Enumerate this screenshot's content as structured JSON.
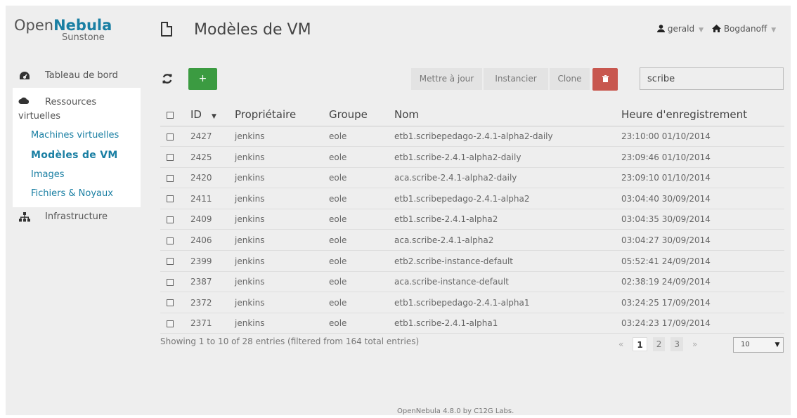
{
  "logo": {
    "open": "Open",
    "nebula": "Nebula",
    "sunstone": "Sunstone"
  },
  "page_title": "Modèles de VM",
  "header": {
    "user": "gerald",
    "zone": "Bogdanoff"
  },
  "sidebar": {
    "dashboard": "Tableau de bord",
    "virtual_resources": {
      "line1": "Ressources",
      "line2": "virtuelles"
    },
    "items": [
      "Machines virtuelles",
      "Modèles de VM",
      "Images",
      "Fichiers & Noyaux"
    ],
    "infrastructure": "Infrastructure"
  },
  "toolbar": {
    "create_label": "+",
    "update_label": "Mettre à jour",
    "instantiate_label": "Instancier",
    "clone_label": "Clone",
    "delete_label": "🗑",
    "search_value": "scribe"
  },
  "table": {
    "columns": [
      "ID",
      "Propriétaire",
      "Groupe",
      "Nom",
      "Heure d'enregistrement"
    ],
    "rows": [
      {
        "id": "2427",
        "owner": "jenkins",
        "group": "eole",
        "name": "etb1.scribepedago-2.4.1-alpha2-daily",
        "time": "23:10:00 01/10/2014"
      },
      {
        "id": "2425",
        "owner": "jenkins",
        "group": "eole",
        "name": "etb1.scribe-2.4.1-alpha2-daily",
        "time": "23:09:46 01/10/2014"
      },
      {
        "id": "2420",
        "owner": "jenkins",
        "group": "eole",
        "name": "aca.scribe-2.4.1-alpha2-daily",
        "time": "23:09:10 01/10/2014"
      },
      {
        "id": "2411",
        "owner": "jenkins",
        "group": "eole",
        "name": "etb1.scribepedago-2.4.1-alpha2",
        "time": "03:04:40 30/09/2014"
      },
      {
        "id": "2409",
        "owner": "jenkins",
        "group": "eole",
        "name": "etb1.scribe-2.4.1-alpha2",
        "time": "03:04:35 30/09/2014"
      },
      {
        "id": "2406",
        "owner": "jenkins",
        "group": "eole",
        "name": "aca.scribe-2.4.1-alpha2",
        "time": "03:04:27 30/09/2014"
      },
      {
        "id": "2399",
        "owner": "jenkins",
        "group": "eole",
        "name": "etb2.scribe-instance-default",
        "time": "05:52:41 24/09/2014"
      },
      {
        "id": "2387",
        "owner": "jenkins",
        "group": "eole",
        "name": "aca.scribe-instance-default",
        "time": "02:38:19 24/09/2014"
      },
      {
        "id": "2372",
        "owner": "jenkins",
        "group": "eole",
        "name": "etb1.scribepedago-2.4.1-alpha1",
        "time": "03:24:25 17/09/2014"
      },
      {
        "id": "2371",
        "owner": "jenkins",
        "group": "eole",
        "name": "etb1.scribe-2.4.1-alpha1",
        "time": "03:24:23 17/09/2014"
      }
    ]
  },
  "showing": "Showing 1 to 10 of 28 entries (filtered from 164 total entries)",
  "pagination": {
    "prev": "«",
    "pages": [
      "1",
      "2",
      "3"
    ],
    "next": "»",
    "page_size": "10"
  },
  "footer": "OpenNebula 4.8.0 by C12G Labs.",
  "colors": {
    "accent": "#1a7fa3",
    "create": "#3b9b41",
    "delete": "#c8574f",
    "background": "#eeeeee"
  }
}
